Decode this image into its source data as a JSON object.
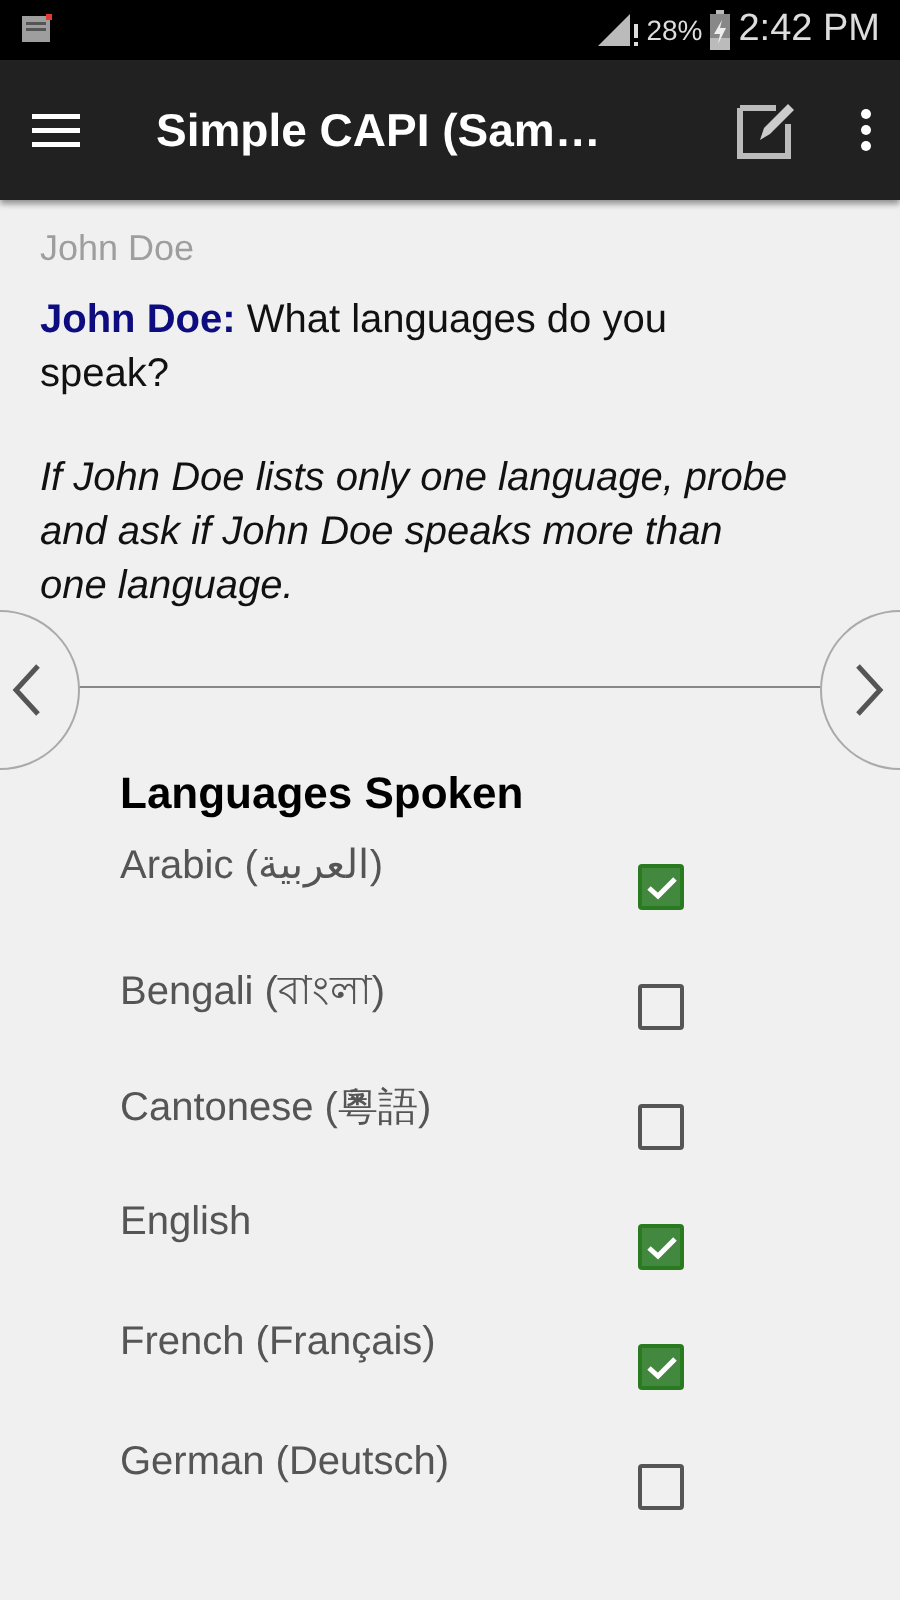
{
  "status_bar": {
    "battery": "28%",
    "time": "2:42 PM"
  },
  "toolbar": {
    "title": "Simple CAPI (Sam…"
  },
  "respondent": "John Doe",
  "question": {
    "speaker": "John Doe:",
    "text": "What languages do you speak?",
    "instruction": "If John Doe lists only one language, probe and ask if John Doe speaks more than one language."
  },
  "field": {
    "title": "Languages Spoken",
    "options": [
      {
        "label": "Arabic (العربية)",
        "checked": true
      },
      {
        "label": "Bengali (বাংলা)",
        "checked": false
      },
      {
        "label": "Cantonese (粵語)",
        "checked": false
      },
      {
        "label": "English",
        "checked": true
      },
      {
        "label": "French (Français)",
        "checked": true
      },
      {
        "label": "German (Deutsch)",
        "checked": false
      }
    ]
  }
}
